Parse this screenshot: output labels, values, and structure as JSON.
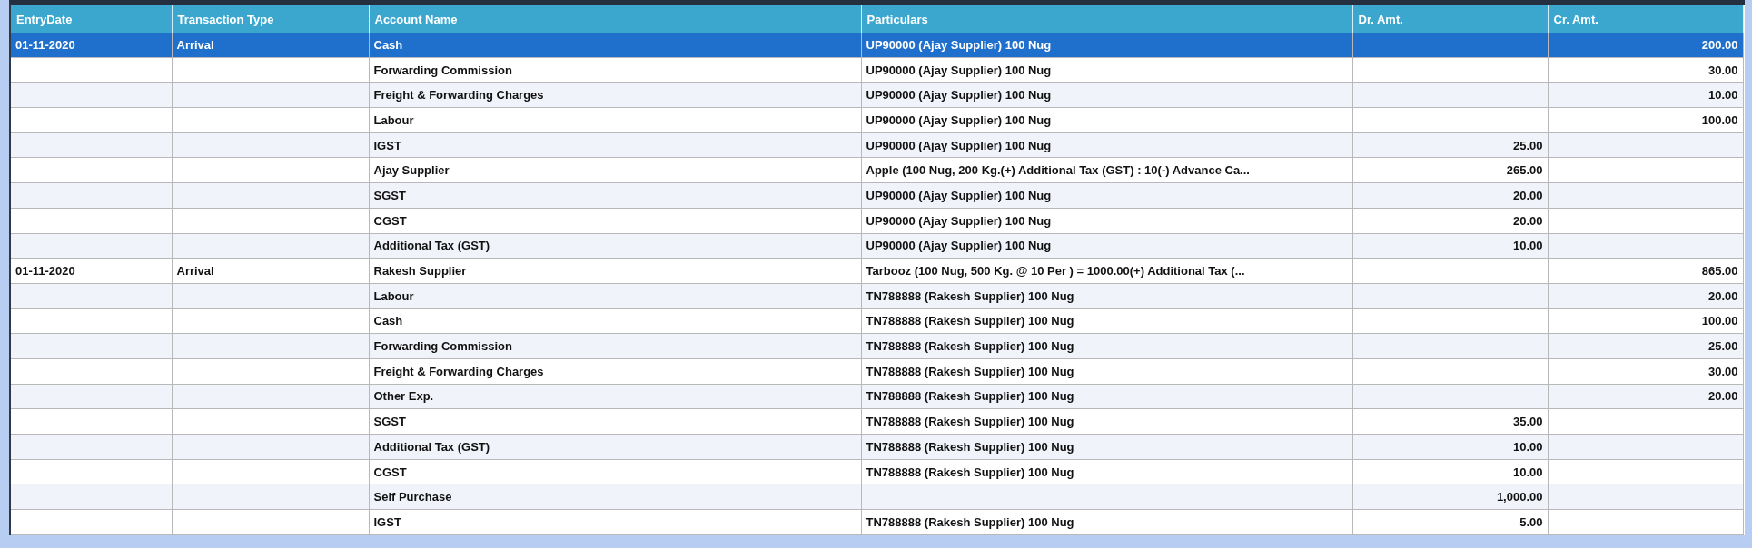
{
  "table": {
    "columns": [
      "EntryDate",
      "Transaction Type",
      "Account Name",
      "Particulars",
      "Dr. Amt.",
      "Cr. Amt."
    ],
    "rows": [
      {
        "selected": true,
        "entry_date": "01-11-2020",
        "transaction_type": "Arrival",
        "account_name": "Cash",
        "particulars": "UP90000  (Ajay Supplier) 100 Nug",
        "cr_amt": "200.00"
      },
      {
        "selected": false,
        "account_name": "Forwarding Commission",
        "particulars": "UP90000  (Ajay Supplier) 100 Nug",
        "cr_amt": "30.00"
      },
      {
        "selected": false,
        "account_name": "Freight & Forwarding Charges",
        "particulars": "UP90000  (Ajay Supplier) 100 Nug",
        "cr_amt": "10.00"
      },
      {
        "selected": false,
        "account_name": "Labour",
        "particulars": "UP90000  (Ajay Supplier) 100 Nug",
        "cr_amt": "100.00"
      },
      {
        "selected": false,
        "account_name": "IGST",
        "particulars": "UP90000  (Ajay Supplier) 100 Nug",
        "dr_amt": "25.00"
      },
      {
        "selected": false,
        "account_name": "Ajay Supplier",
        "particulars": "Apple (100 Nug, 200 Kg.(+) Additional Tax (GST) : 10(-) Advance Ca...",
        "dr_amt": "265.00"
      },
      {
        "selected": false,
        "account_name": "SGST",
        "particulars": "UP90000  (Ajay Supplier) 100 Nug",
        "dr_amt": "20.00"
      },
      {
        "selected": false,
        "account_name": "CGST",
        "particulars": "UP90000  (Ajay Supplier) 100 Nug",
        "dr_amt": "20.00"
      },
      {
        "selected": false,
        "account_name": "Additional Tax (GST)",
        "particulars": "UP90000  (Ajay Supplier) 100 Nug",
        "dr_amt": "10.00"
      },
      {
        "selected": false,
        "entry_date": "01-11-2020",
        "transaction_type": "Arrival",
        "account_name": "Rakesh Supplier",
        "particulars": "Tarbooz (100 Nug, 500 Kg. @ 10 Per )  = 1000.00(+) Additional Tax (...",
        "cr_amt": "865.00"
      },
      {
        "selected": false,
        "account_name": "Labour",
        "particulars": "TN788888  (Rakesh Supplier) 100 Nug",
        "cr_amt": "20.00"
      },
      {
        "selected": false,
        "account_name": "Cash",
        "particulars": "TN788888  (Rakesh Supplier) 100 Nug",
        "cr_amt": "100.00"
      },
      {
        "selected": false,
        "account_name": "Forwarding Commission",
        "particulars": "TN788888  (Rakesh Supplier) 100 Nug",
        "cr_amt": "25.00"
      },
      {
        "selected": false,
        "account_name": "Freight & Forwarding Charges",
        "particulars": "TN788888  (Rakesh Supplier) 100 Nug",
        "cr_amt": "30.00"
      },
      {
        "selected": false,
        "account_name": "Other Exp.",
        "particulars": "TN788888  (Rakesh Supplier) 100 Nug",
        "cr_amt": "20.00"
      },
      {
        "selected": false,
        "account_name": "SGST",
        "particulars": "TN788888  (Rakesh Supplier) 100 Nug",
        "dr_amt": "35.00"
      },
      {
        "selected": false,
        "account_name": "Additional Tax (GST)",
        "particulars": "TN788888  (Rakesh Supplier) 100 Nug",
        "dr_amt": "10.00"
      },
      {
        "selected": false,
        "account_name": "CGST",
        "particulars": "TN788888  (Rakesh Supplier) 100 Nug",
        "dr_amt": "10.00"
      },
      {
        "selected": false,
        "account_name": "Self Purchase",
        "dr_amt": "1,000.00"
      },
      {
        "selected": false,
        "account_name": "IGST",
        "particulars": "TN788888  (Rakesh Supplier) 100 Nug",
        "dr_amt": "5.00"
      }
    ]
  }
}
